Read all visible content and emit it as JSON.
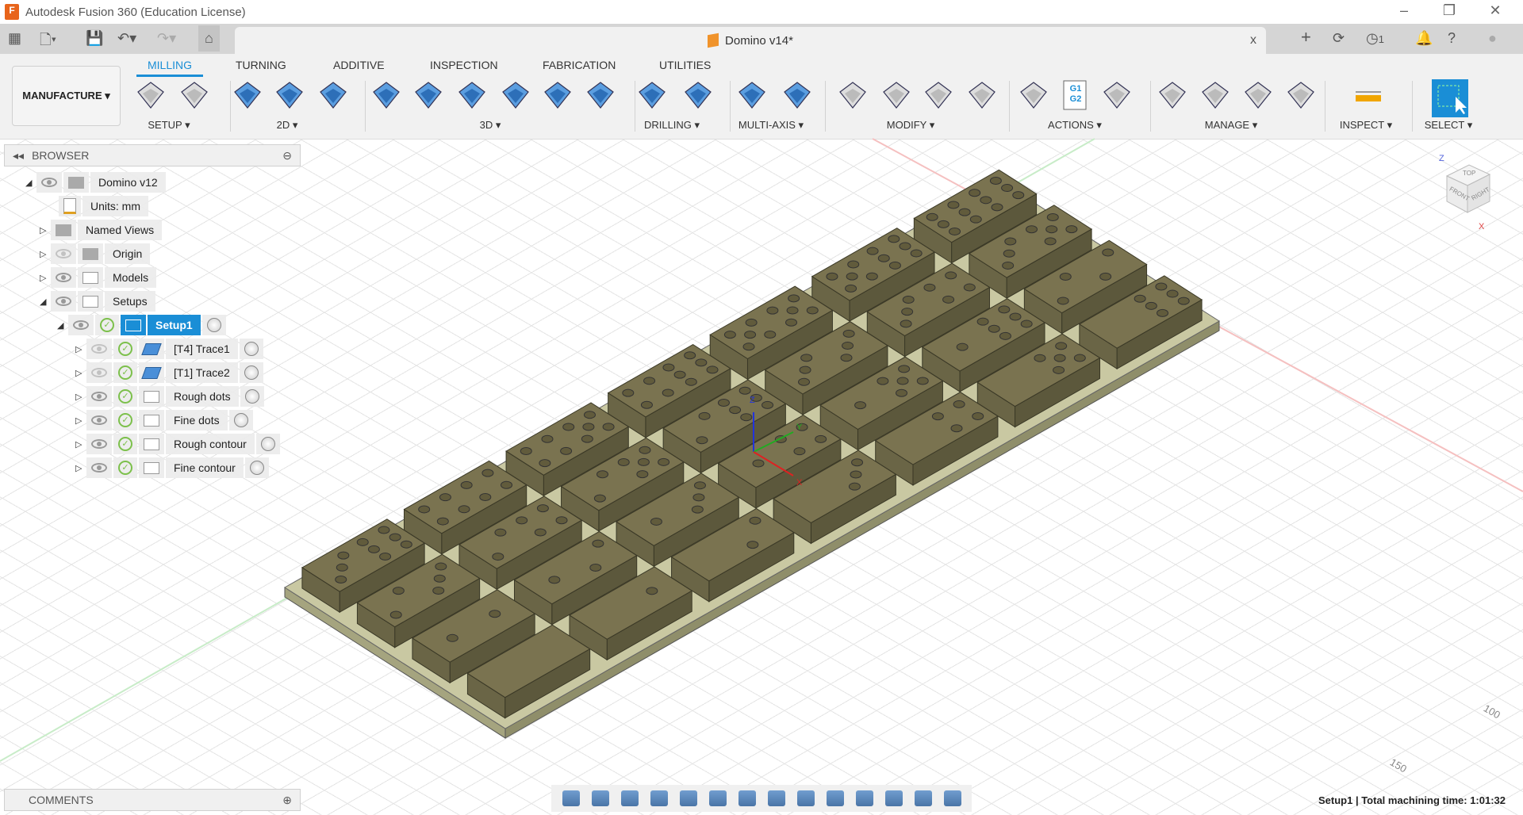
{
  "window": {
    "title": "Autodesk Fusion 360 (Education License)",
    "minimize": "–",
    "restore": "❐",
    "close": "✕"
  },
  "document": {
    "tab_title": "Domino v14*",
    "close": "x",
    "notification_count": "1"
  },
  "workspace": {
    "label": "MANUFACTURE ▾"
  },
  "ribbon_tabs": [
    {
      "label": "MILLING",
      "active": true
    },
    {
      "label": "TURNING"
    },
    {
      "label": "ADDITIVE"
    },
    {
      "label": "INSPECTION"
    },
    {
      "label": "FABRICATION"
    },
    {
      "label": "UTILITIES"
    }
  ],
  "groups": [
    {
      "label": "SETUP ▾"
    },
    {
      "label": "2D ▾"
    },
    {
      "label": "3D ▾"
    },
    {
      "label": "DRILLING ▾"
    },
    {
      "label": "MULTI-AXIS ▾"
    },
    {
      "label": "MODIFY ▾"
    },
    {
      "label": "ACTIONS ▾"
    },
    {
      "label": "MANAGE ▾"
    },
    {
      "label": "INSPECT ▾"
    },
    {
      "label": "SELECT ▾"
    }
  ],
  "actions_g_code": "G1 G2",
  "browser": {
    "title": "BROWSER",
    "items": [
      {
        "label": "Domino v12"
      },
      {
        "label": "Units: mm"
      },
      {
        "label": "Named Views"
      },
      {
        "label": "Origin"
      },
      {
        "label": "Models"
      },
      {
        "label": "Setups"
      },
      {
        "label": "Setup1"
      },
      {
        "label": "[T4] Trace1"
      },
      {
        "label": "[T1] Trace2"
      },
      {
        "label": "Rough dots"
      },
      {
        "label": "Fine dots"
      },
      {
        "label": "Rough contour"
      },
      {
        "label": "Fine contour"
      }
    ]
  },
  "comments": {
    "title": "COMMENTS"
  },
  "status": {
    "text": "Setup1 | Total machining time: 1:01:32"
  },
  "viewcube": {
    "top": "TOP",
    "front": "FRONT",
    "right": "RIGHT",
    "z": "Z",
    "x": "X"
  },
  "triad": {
    "z": "Z",
    "y": "Y",
    "x": "X"
  },
  "rulers": {
    "a": "100",
    "b": "150"
  },
  "colors": {
    "accent": "#1a8ed6",
    "domino": "#7a7350",
    "board": "#c9c8a2"
  }
}
